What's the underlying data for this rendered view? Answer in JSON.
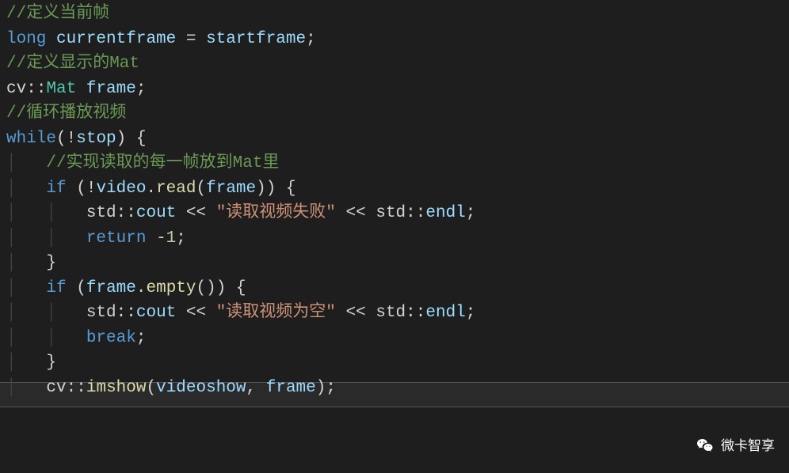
{
  "code": {
    "l1_comment": "//定义当前帧",
    "l2_long": "long",
    "l2_var": " currentframe ",
    "l2_eq": "= ",
    "l2_val": "startframe",
    "l2_semi": ";",
    "l3_comment": "//定义显示的Mat",
    "l4_ns": "cv",
    "l4_scope": "::",
    "l4_type": "Mat",
    "l4_var": " frame",
    "l4_semi": ";",
    "l5_comment": "//循环播放视频",
    "l6_while": "while",
    "l6_open": "(!",
    "l6_var": "stop",
    "l6_close": ") {",
    "l7_comment": "//实现读取的每一帧放到Mat里",
    "l8_if": "if",
    "l8_open": " (!",
    "l8_var": "video",
    "l8_dot": ".",
    "l8_fn": "read",
    "l8_paren": "(",
    "l8_arg": "frame",
    "l8_close": ")) {",
    "l9_std": "std",
    "l9_scope": "::",
    "l9_cout": "cout",
    "l9_op1": " << ",
    "l9_str": "\"读取视频失败\"",
    "l9_op2": " << ",
    "l9_std2": "std",
    "l9_scope2": "::",
    "l9_endl": "endl",
    "l9_semi": ";",
    "l10_return": "return",
    "l10_sp": " ",
    "l10_neg": "-",
    "l10_num": "1",
    "l10_semi": ";",
    "l11_brace": "}",
    "l12_if": "if",
    "l12_open": " (",
    "l12_var": "frame",
    "l12_dot": ".",
    "l12_fn": "empty",
    "l12_close": "()) {",
    "l13_std": "std",
    "l13_scope": "::",
    "l13_cout": "cout",
    "l13_op1": " << ",
    "l13_str": "\"读取视频为空\"",
    "l13_op2": " << ",
    "l13_std2": "std",
    "l13_scope2": "::",
    "l13_endl": "endl",
    "l13_semi": ";",
    "l14_break": "break",
    "l14_semi": ";",
    "l15_brace": "}",
    "l16_ns": "cv",
    "l16_scope": "::",
    "l16_fn": "imshow",
    "l16_open": "(",
    "l16_arg1": "videoshow",
    "l16_comma": ", ",
    "l16_arg2": "frame",
    "l16_close": ");"
  },
  "watermark": {
    "text": "微卡智享"
  },
  "indent": {
    "i1": "    ",
    "i2": "        ",
    "guide1": "│   ",
    "guide2": "│   │   "
  }
}
